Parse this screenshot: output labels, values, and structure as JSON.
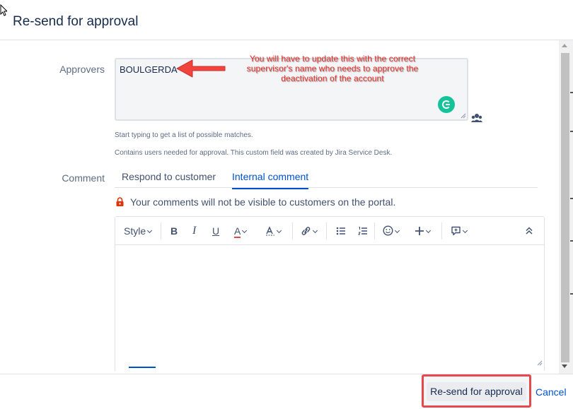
{
  "dialog": {
    "title": "Re-send for approval"
  },
  "approvers": {
    "label": "Approvers",
    "value": "BOULGERDA",
    "help_text_1": "Start typing to get a list of possible matches.",
    "help_text_2": "Contains users needed for approval. This custom field was created by Jira Service Desk."
  },
  "annotation": {
    "text": "You will have to update this with the correct supervisor's name who needs to approve the deactivation of the account",
    "color": "#e8322c"
  },
  "comment": {
    "label": "Comment",
    "tabs": [
      {
        "label": "Respond to customer",
        "active": false
      },
      {
        "label": "Internal comment",
        "active": true
      }
    ],
    "privacy_note": "Your comments will not be visible to customers on the portal."
  },
  "toolbar": {
    "style_label": "Style",
    "bold": "B",
    "italic": "I",
    "underline": "U",
    "text_color": "A",
    "icons": [
      "chevron-down-icon",
      "text-effects-icon",
      "link-icon",
      "bullet-list-icon",
      "numbered-list-icon",
      "emoji-icon",
      "plus-icon",
      "insert-comment-icon",
      "collapse-icon"
    ]
  },
  "footer": {
    "resend_label": "Re-send for approval",
    "cancel_label": "Cancel"
  },
  "colors": {
    "accent": "#0052cc",
    "highlight_border": "#e5484d",
    "grammarly": "#15c39a"
  }
}
